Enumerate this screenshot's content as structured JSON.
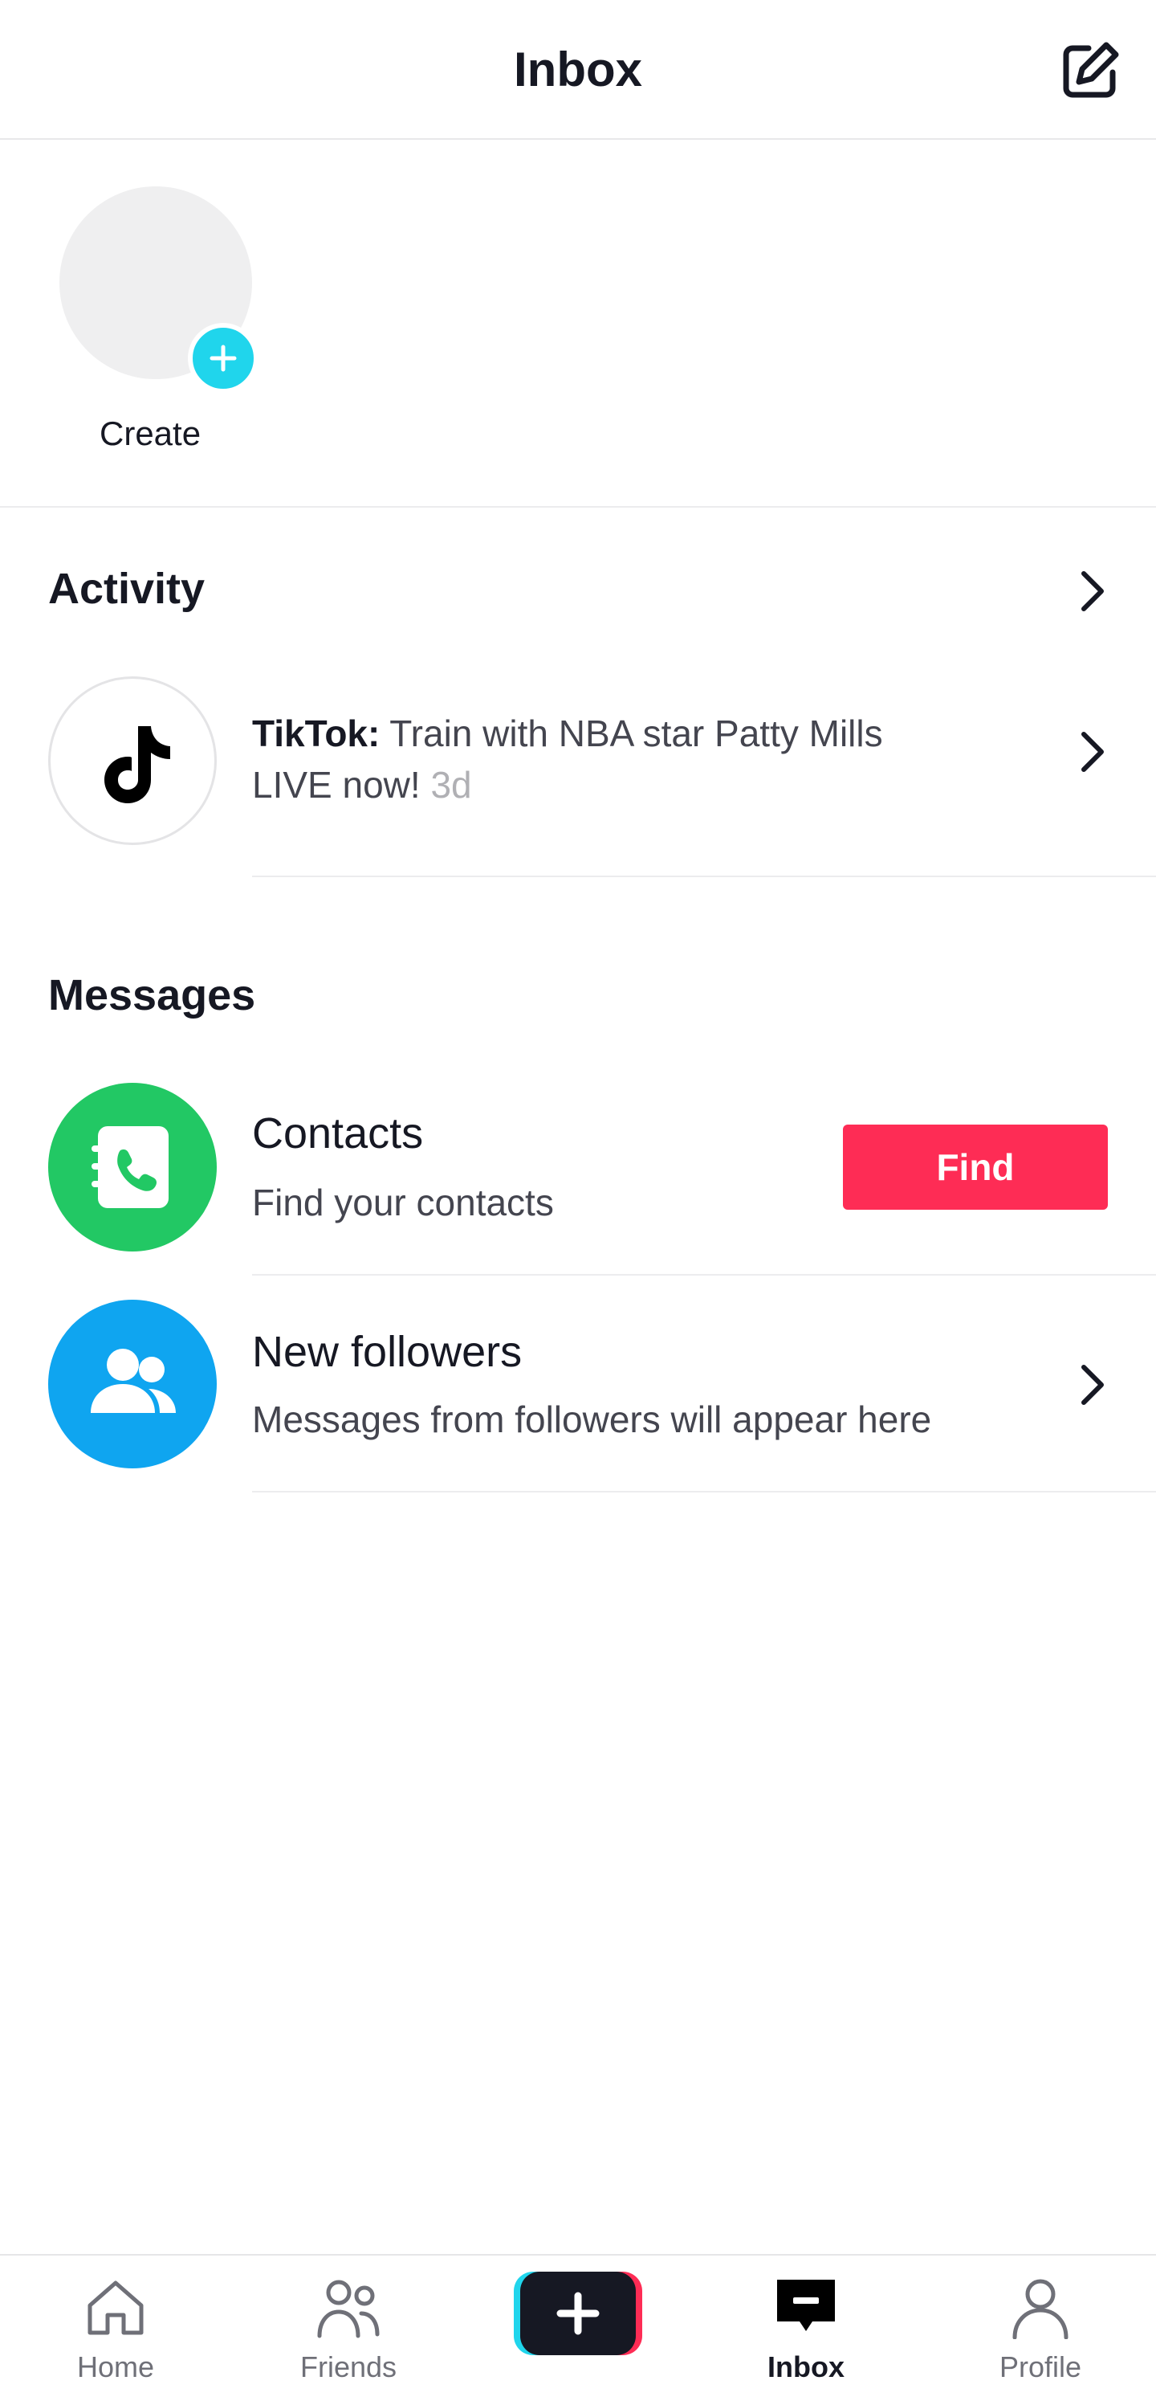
{
  "header": {
    "title": "Inbox",
    "compose_icon": "compose-edit-icon"
  },
  "stories": {
    "create_label": "Create",
    "plus_color": "#20d5ec"
  },
  "activity": {
    "title": "Activity",
    "item": {
      "sender": "TikTok:",
      "text": "Train with NBA star Patty Mills",
      "text2": "LIVE now!",
      "time": "3d"
    }
  },
  "messages": {
    "title": "Messages",
    "contacts": {
      "title": "Contacts",
      "subtitle": "Find your contacts",
      "button": "Find",
      "icon_color": "#22c864"
    },
    "followers": {
      "title": "New followers",
      "subtitle": "Messages from followers will appear here",
      "icon_color": "#0fa5f0"
    }
  },
  "tabs": [
    {
      "label": "Home",
      "icon": "home-icon"
    },
    {
      "label": "Friends",
      "icon": "friends-icon"
    },
    {
      "label": "",
      "icon": "create-plus-icon"
    },
    {
      "label": "Inbox",
      "icon": "inbox-icon",
      "active": true
    },
    {
      "label": "Profile",
      "icon": "profile-icon"
    }
  ],
  "colors": {
    "accent": "#fe2c55",
    "text": "#161823",
    "secondary": "#44454f"
  }
}
